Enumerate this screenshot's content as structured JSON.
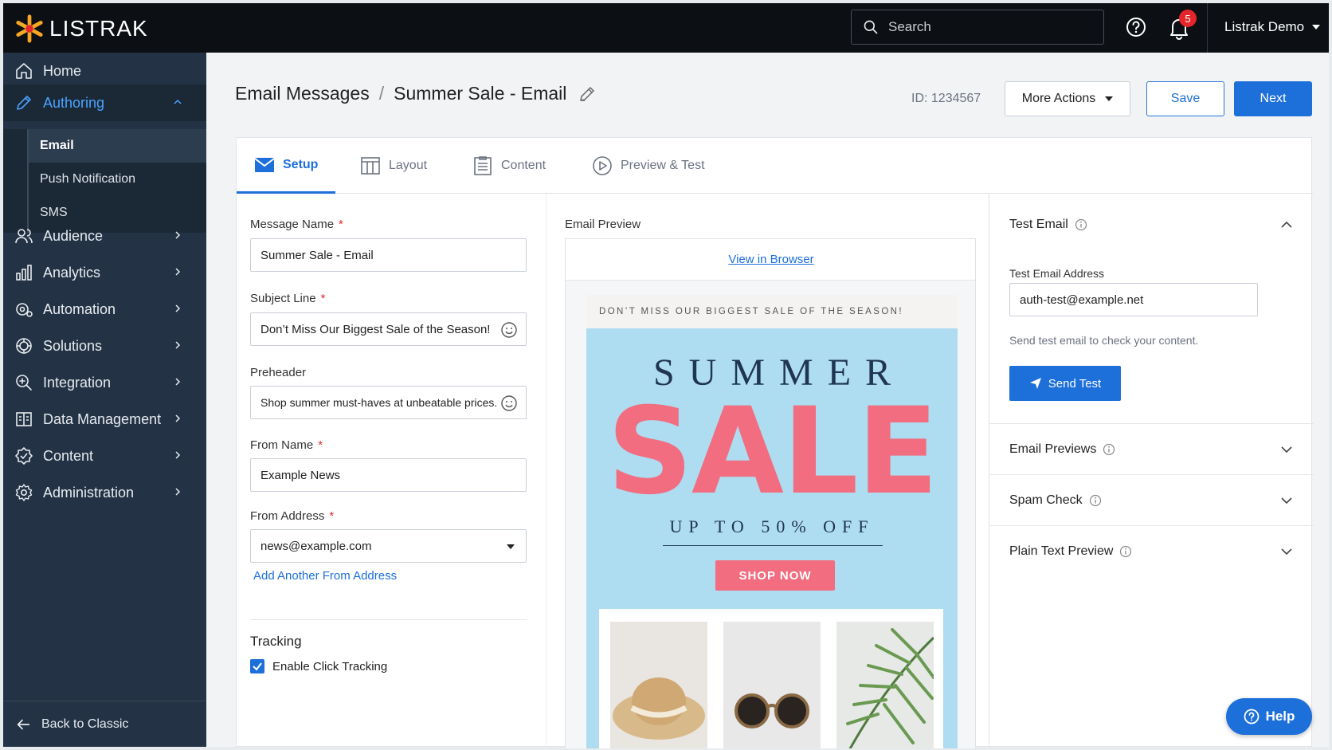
{
  "app": {
    "logo_text": "LISTRAK",
    "brand_color": "#1d6fd9",
    "logo_color": "#f5a623"
  },
  "topbar": {
    "search_placeholder": "Search",
    "notification_count": "5",
    "user_name": "Listrak Demo",
    "icons": [
      "search-icon",
      "help-circle-icon",
      "bell-icon"
    ]
  },
  "sidebar": {
    "items": [
      {
        "label": "Home",
        "icon": "home-icon"
      },
      {
        "label": "Authoring",
        "icon": "pencil-icon",
        "active": true
      },
      {
        "label": "Audience",
        "icon": "users-icon"
      },
      {
        "label": "Analytics",
        "icon": "bar-chart-icon"
      },
      {
        "label": "Automation",
        "icon": "automation-icon"
      },
      {
        "label": "Solutions",
        "icon": "solutions-icon"
      },
      {
        "label": "Integration",
        "icon": "integration-icon"
      },
      {
        "label": "Data Management",
        "icon": "data-management-icon"
      },
      {
        "label": "Content",
        "icon": "content-icon"
      },
      {
        "label": "Administration",
        "icon": "gear-icon"
      }
    ],
    "sub_items": [
      {
        "label": "Email",
        "selected": true
      },
      {
        "label": "Push Notification"
      },
      {
        "label": "SMS"
      }
    ],
    "back_label": "Back to Classic"
  },
  "header": {
    "breadcrumb_root": "Email Messages",
    "breadcrumb_separator": "/",
    "breadcrumb_current": "Summer Sale - Email",
    "id_text": "ID: 1234567",
    "more_actions": "More Actions",
    "save": "Save",
    "next": "Next"
  },
  "tabs": [
    {
      "label": "Setup",
      "icon": "envelope-icon",
      "active": true
    },
    {
      "label": "Layout",
      "icon": "layout-icon"
    },
    {
      "label": "Content",
      "icon": "document-icon"
    },
    {
      "label": "Preview & Test",
      "icon": "play-circle-icon"
    }
  ],
  "form": {
    "message_name_label": "Message Name",
    "message_name_value": "Summer Sale - Email",
    "subject_label": "Subject Line",
    "subject_value": "Don’t Miss Our Biggest Sale of the Season!",
    "preheader_label": "Preheader",
    "preheader_value": "Shop summer must-haves at unbeatable prices.",
    "from_name_label": "From Name",
    "from_name_value": "Example News",
    "from_address_label": "From Address",
    "from_address_value": "news@example.com",
    "add_from_link": "Add Another From Address",
    "required_mark": "*",
    "tracking_title": "Tracking",
    "click_tracking_label": "Enable Click Tracking",
    "click_tracking_checked": true
  },
  "preview": {
    "label": "Email Preview",
    "view_in_browser": "View in Browser",
    "preheader_banner": "DON’T MISS OUR BIGGEST SALE OF THE SEASON!",
    "hero_line1": "SUMMER",
    "hero_line2": "SALE",
    "hero_line3": "UP TO 50% OFF",
    "cta": "SHOP NOW",
    "hero_bg": "#aedcf0",
    "accent_pink": "#f26d7f"
  },
  "right_panel": {
    "test_email_title": "Test Email",
    "test_email_address_label": "Test Email Address",
    "test_email_address_value": "auth-test@example.net",
    "test_hint": "Send test email to check your content.",
    "send_test": "Send Test",
    "sections": [
      {
        "title": "Email Previews"
      },
      {
        "title": "Spam Check"
      },
      {
        "title": "Plain Text Preview"
      }
    ]
  },
  "help_button": "Help"
}
